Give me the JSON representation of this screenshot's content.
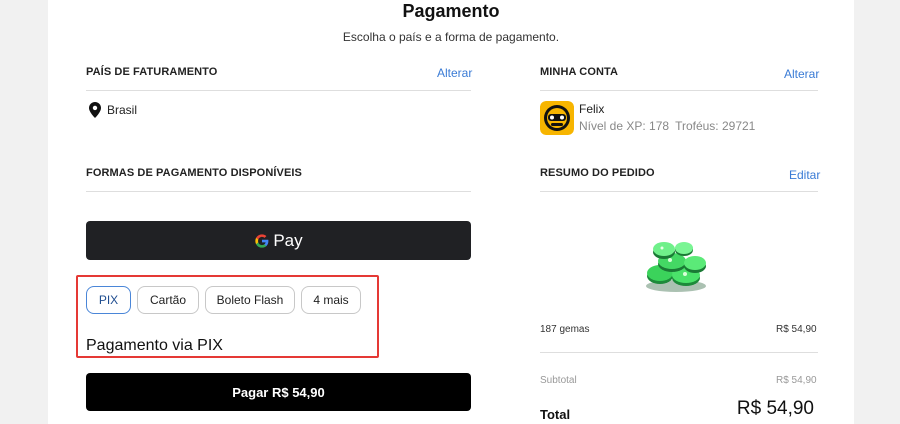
{
  "header": {
    "title": "Pagamento",
    "subtitle": "Escolha o país e a forma de pagamento."
  },
  "billing": {
    "label": "PAÍS DE FATURAMENTO",
    "change_link": "Alterar",
    "country": "Brasil"
  },
  "payment_methods": {
    "label": "FORMAS DE PAGAMENTO DISPONÍVEIS",
    "gpay_label": "Pay",
    "tabs": [
      "PIX",
      "Cartão",
      "Boleto Flash",
      "4 mais"
    ],
    "selected_title": "Pagamento via PIX",
    "pay_button": "Pagar R$ 54,90"
  },
  "account": {
    "label": "MINHA CONTA",
    "change_link": "Alterar",
    "name": "Felix",
    "xp": "Nível de XP: 178",
    "trophies": "Troféus: 29721"
  },
  "order": {
    "label": "RESUMO DO PEDIDO",
    "edit_link": "Editar",
    "item_name": "187 gemas",
    "item_price": "R$ 54,90",
    "subtotal_label": "Subtotal",
    "subtotal_value": "R$ 54,90",
    "total_label": "Total",
    "total_value": "R$ 54,90"
  },
  "colors": {
    "accent_link": "#3a7bd5",
    "highlight_box": "#e53935",
    "gpay_bg": "#202124",
    "pay_button_bg": "#000000"
  }
}
